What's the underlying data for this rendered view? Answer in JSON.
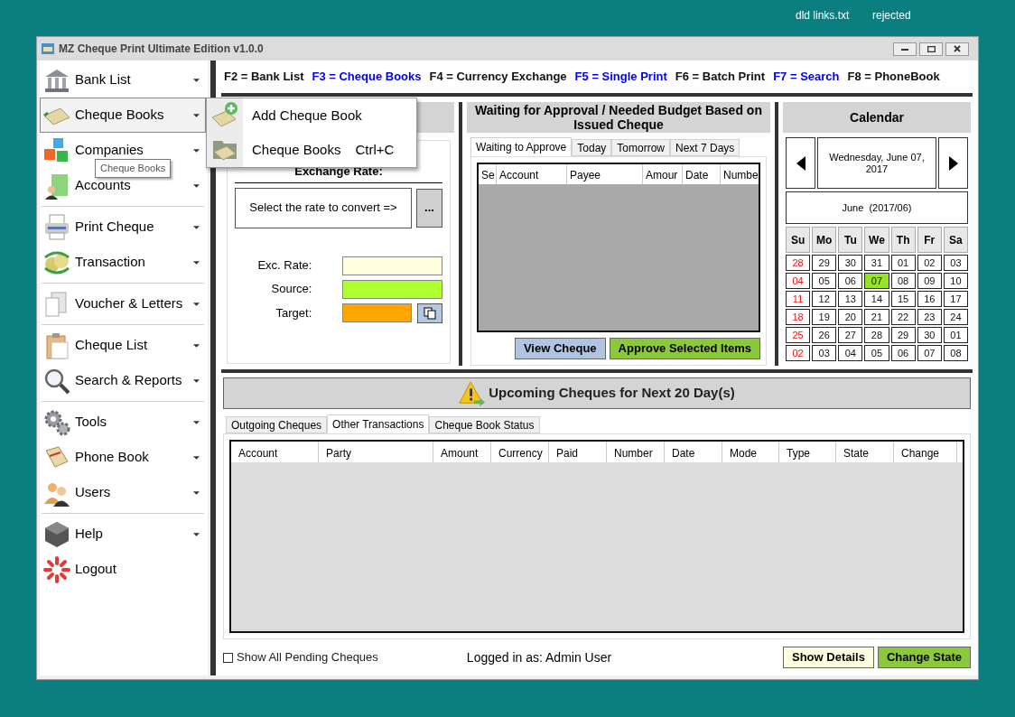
{
  "desktop_icons": [
    {
      "label": "dld links.txt"
    },
    {
      "label": "rejected"
    }
  ],
  "window": {
    "title": "MZ Cheque Print Ultimate Edition v1.0.0"
  },
  "sidebar": {
    "groups": [
      [
        {
          "label": "Bank List",
          "has_submenu": true,
          "selected": false
        },
        {
          "label": "Cheque Books",
          "has_submenu": true,
          "selected": true
        },
        {
          "label": "Companies",
          "has_submenu": true,
          "selected": false
        },
        {
          "label": "Accounts",
          "has_submenu": true,
          "selected": false
        }
      ],
      [
        {
          "label": "Print Cheque",
          "has_submenu": true,
          "selected": false
        },
        {
          "label": "Transaction",
          "has_submenu": true,
          "selected": false
        }
      ],
      [
        {
          "label": "Voucher & Letters",
          "has_submenu": true,
          "selected": false
        }
      ],
      [
        {
          "label": "Cheque List",
          "has_submenu": true,
          "selected": false
        },
        {
          "label": "Search & Reports",
          "has_submenu": true,
          "selected": false
        }
      ],
      [
        {
          "label": "Tools",
          "has_submenu": true,
          "selected": false
        },
        {
          "label": "Phone Book",
          "has_submenu": true,
          "selected": false
        },
        {
          "label": "Users",
          "has_submenu": true,
          "selected": false
        }
      ],
      [
        {
          "label": "Help",
          "has_submenu": true,
          "selected": false
        },
        {
          "label": "Logout",
          "has_submenu": false,
          "selected": false
        }
      ]
    ]
  },
  "submenu": {
    "items": [
      {
        "label": "Add Cheque Book"
      },
      {
        "label": "Cheque Books",
        "shortcut": "Ctrl+C"
      }
    ]
  },
  "tooltip": "Cheque Books",
  "hotkeys": [
    {
      "text": "F2 = Bank List",
      "highlighted": false
    },
    {
      "text": "F3 = Cheque Books",
      "highlighted": true
    },
    {
      "text": "F4 = Currency Exchange",
      "highlighted": false
    },
    {
      "text": "F5 = Single Print",
      "highlighted": true
    },
    {
      "text": "F6 = Batch Print",
      "highlighted": false
    },
    {
      "text": "F7 = Search",
      "highlighted": true
    },
    {
      "text": "F8 = PhoneBook",
      "highlighted": false
    }
  ],
  "exchange": {
    "title": "Exchange Rate:",
    "selector": "Select the rate to convert =>",
    "browse_button": "...",
    "fields": [
      {
        "label": "Exc. Rate:",
        "color": "#ffffe0"
      },
      {
        "label": "Source:",
        "color": "#adff2f"
      },
      {
        "label": "Target:",
        "color": "#ffa500"
      }
    ]
  },
  "approval": {
    "title": "Waiting for Approval / Needed Budget Based on Issued Cheque",
    "tabs": [
      {
        "label": "Waiting to Approve",
        "selected": true
      },
      {
        "label": "Today",
        "selected": false
      },
      {
        "label": "Tomorrow",
        "selected": false
      },
      {
        "label": "Next 7 Days",
        "selected": false
      }
    ],
    "columns": [
      "Se",
      "Account",
      "Payee",
      "Amour",
      "Date",
      "Numbe"
    ],
    "buttons": [
      {
        "label": "View Cheque",
        "kind": "secondary"
      },
      {
        "label": "Approve Selected Items",
        "kind": "primary"
      }
    ]
  },
  "calendar": {
    "title": "Calendar",
    "date": "Wednesday, June 07, 2017",
    "month": "June  (2017/06)",
    "weekdays": [
      "Su",
      "Mo",
      "Tu",
      "We",
      "Th",
      "Fr",
      "Sa"
    ],
    "weeks": [
      [
        {
          "text": "28",
          "weekend": true,
          "selected": false
        },
        {
          "text": "29",
          "weekend": false,
          "selected": false
        },
        {
          "text": "30",
          "weekend": false,
          "selected": false
        },
        {
          "text": "31",
          "weekend": false,
          "selected": false
        },
        {
          "text": "01",
          "weekend": false,
          "selected": false
        },
        {
          "text": "02",
          "weekend": false,
          "selected": false
        },
        {
          "text": "03",
          "weekend": false,
          "selected": false
        }
      ],
      [
        {
          "text": "04",
          "weekend": true,
          "selected": false
        },
        {
          "text": "05",
          "weekend": false,
          "selected": false
        },
        {
          "text": "06",
          "weekend": false,
          "selected": false
        },
        {
          "text": "07",
          "weekend": false,
          "selected": true
        },
        {
          "text": "08",
          "weekend": false,
          "selected": false
        },
        {
          "text": "09",
          "weekend": false,
          "selected": false
        },
        {
          "text": "10",
          "weekend": false,
          "selected": false
        }
      ],
      [
        {
          "text": "11",
          "weekend": true,
          "selected": false
        },
        {
          "text": "12",
          "weekend": false,
          "selected": false
        },
        {
          "text": "13",
          "weekend": false,
          "selected": false
        },
        {
          "text": "14",
          "weekend": false,
          "selected": false
        },
        {
          "text": "15",
          "weekend": false,
          "selected": false
        },
        {
          "text": "16",
          "weekend": false,
          "selected": false
        },
        {
          "text": "17",
          "weekend": false,
          "selected": false
        }
      ],
      [
        {
          "text": "18",
          "weekend": true,
          "selected": false
        },
        {
          "text": "19",
          "weekend": false,
          "selected": false
        },
        {
          "text": "20",
          "weekend": false,
          "selected": false
        },
        {
          "text": "21",
          "weekend": false,
          "selected": false
        },
        {
          "text": "22",
          "weekend": false,
          "selected": false
        },
        {
          "text": "23",
          "weekend": false,
          "selected": false
        },
        {
          "text": "24",
          "weekend": false,
          "selected": false
        }
      ],
      [
        {
          "text": "25",
          "weekend": true,
          "selected": false
        },
        {
          "text": "26",
          "weekend": false,
          "selected": false
        },
        {
          "text": "27",
          "weekend": false,
          "selected": false
        },
        {
          "text": "28",
          "weekend": false,
          "selected": false
        },
        {
          "text": "29",
          "weekend": false,
          "selected": false
        },
        {
          "text": "30",
          "weekend": false,
          "selected": false
        },
        {
          "text": "01",
          "weekend": false,
          "selected": false
        }
      ],
      [
        {
          "text": "02",
          "weekend": true,
          "selected": false
        },
        {
          "text": "03",
          "weekend": false,
          "selected": false
        },
        {
          "text": "04",
          "weekend": false,
          "selected": false
        },
        {
          "text": "05",
          "weekend": false,
          "selected": false
        },
        {
          "text": "06",
          "weekend": false,
          "selected": false
        },
        {
          "text": "07",
          "weekend": false,
          "selected": false
        },
        {
          "text": "08",
          "weekend": false,
          "selected": false
        }
      ]
    ]
  },
  "upcoming": {
    "title": "Upcoming Cheques for Next 20 Day(s)",
    "tabs": [
      {
        "label": "Outgoing Cheques",
        "selected": false
      },
      {
        "label": "Other Transactions",
        "selected": true
      },
      {
        "label": "Cheque Book Status",
        "selected": false
      }
    ],
    "columns": [
      "Account",
      "Party",
      "Amount",
      "Currency",
      "Paid",
      "Number",
      "Date",
      "Mode",
      "Type",
      "State",
      "Change"
    ]
  },
  "footer": {
    "show_all": {
      "label": "Show All Pending Cheques",
      "checked": false
    },
    "login": "Logged in as: Admin User",
    "buttons": [
      {
        "label": "Show Details",
        "kind": "secondary"
      },
      {
        "label": "Change State",
        "kind": "primary"
      }
    ]
  }
}
